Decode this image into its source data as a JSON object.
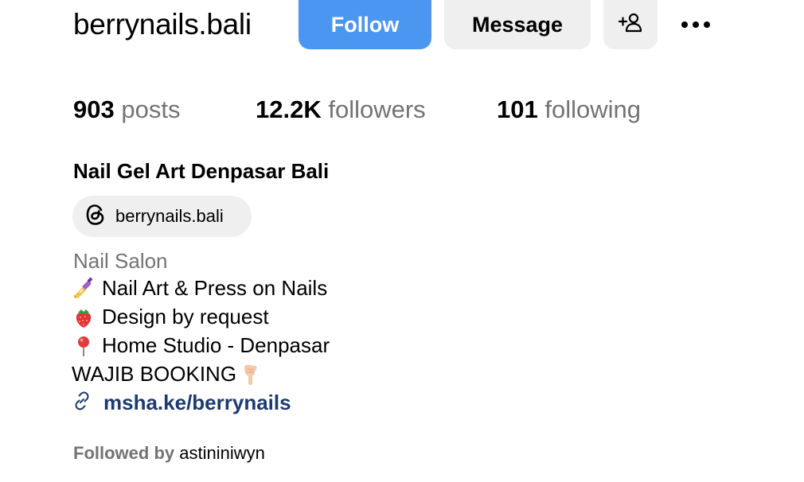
{
  "profile": {
    "username": "berrynails.bali",
    "full_name": "Nail Gel Art Denpasar Bali",
    "category": "Nail Salon"
  },
  "actions": {
    "follow_label": "Follow",
    "message_label": "Message",
    "add_user_icon": "person-add-icon",
    "more_icon": "ellipsis-icon"
  },
  "stats": {
    "posts": {
      "count": "903",
      "label": "posts"
    },
    "followers": {
      "count": "12.2K",
      "label": "followers"
    },
    "following": {
      "count": "101",
      "label": "following"
    }
  },
  "threads": {
    "handle": "berrynails.bali",
    "icon": "threads-icon"
  },
  "bio": {
    "lines": [
      {
        "icon": "nail-polish-emoji",
        "text": "Nail Art & Press on Nails"
      },
      {
        "icon": "strawberry-emoji",
        "text": "Design by request"
      },
      {
        "icon": "pushpin-emoji",
        "text": "Home Studio - Denpasar"
      },
      {
        "icon": "pointing-down-emoji",
        "text": "WAJIB BOOKING"
      }
    ]
  },
  "link": {
    "icon": "link-icon",
    "text": "msha.ke/berrynails"
  },
  "followed_by": {
    "prefix": "Followed by",
    "names": "astininiwyn"
  },
  "colors": {
    "follow_blue": "#4a96f0",
    "button_gray": "#efefef",
    "secondary_text": "#737373",
    "link_text": "#1d3a6e"
  }
}
